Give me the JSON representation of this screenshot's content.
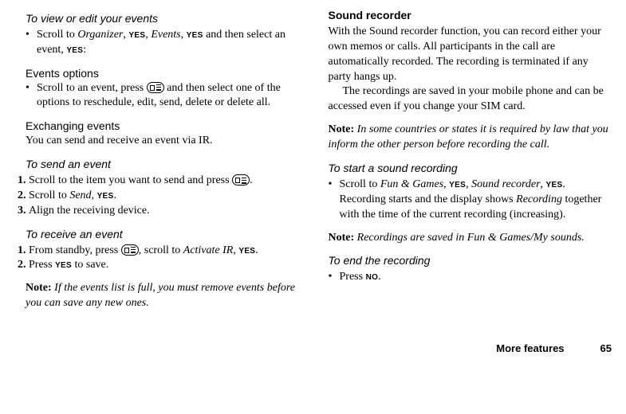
{
  "left": {
    "heading_view": "To view or edit your events",
    "view_text_pre": "Scroll to ",
    "view_org": "Organizer",
    "view_comma1": ", ",
    "view_yes1": "YES",
    "view_comma2": ", ",
    "view_events": "Events",
    "view_comma3": ", ",
    "view_yes2": "YES",
    "view_rest": " and then select an event, ",
    "view_yes3": "YES",
    "view_colon": ":",
    "events_options": "Events options",
    "options_text_pre": "Scroll to an event, press ",
    "options_rest": " and then select one of the options to reschedule, edit, send, delete or delete all.",
    "exchanging": "Exchanging events",
    "exchanging_body": "You can send and receive an event via IR.",
    "heading_send": "To send an event",
    "send_1_pre": "Scroll to the item you want to send and press ",
    "send_1_post": ".",
    "send_2_pre": "Scroll to ",
    "send_2_em": "Send",
    "send_2_comma": ", ",
    "send_2_yes": "YES",
    "send_2_post": ".",
    "send_3": "Align the receiving device.",
    "heading_receive": "To receive an event",
    "recv_1_pre": "From standby, press ",
    "recv_1_mid": ", scroll to ",
    "recv_1_em": "Activate IR",
    "recv_1_comma": ", ",
    "recv_1_yes": "YES",
    "recv_1_post": ".",
    "recv_2_pre": "Press ",
    "recv_2_yes": "YES",
    "recv_2_post": " to save.",
    "note_bold": "Note:",
    "note_em": " If the events list is full, you must remove events before you can save any new ones."
  },
  "right": {
    "heading_sr": "Sound recorder",
    "sr_body1": "With the Sound recorder function, you can record either your own memos or calls. All participants in the call are automatically recorded. The recording is terminated if any party hangs up.",
    "sr_body2": "The recordings are saved in your mobile phone and can be accessed even if you change your SIM card.",
    "note1_bold": "Note:",
    "note1_em": " In some countries or states it is required by law that you inform the other person before recording the call.",
    "heading_start": "To start a sound recording",
    "start_pre": "Scroll to ",
    "start_fg": "Fun & Games",
    "start_c1": ", ",
    "start_y1": "YES",
    "start_c2": ", ",
    "start_sr": "Sound recorder",
    "start_c3": ", ",
    "start_y2": "YES",
    "start_post1": ". Recording starts and the display shows ",
    "start_rec": "Recording",
    "start_post2": " together with the time of the current recording (increasing).",
    "note2_bold": "Note:",
    "note2_em": " Recordings are saved in Fun & Games/My sounds.",
    "heading_end": "To end the recording",
    "end_pre": "Press ",
    "end_no": "NO",
    "end_post": "."
  },
  "footer": {
    "section": "More features",
    "page": "65"
  }
}
